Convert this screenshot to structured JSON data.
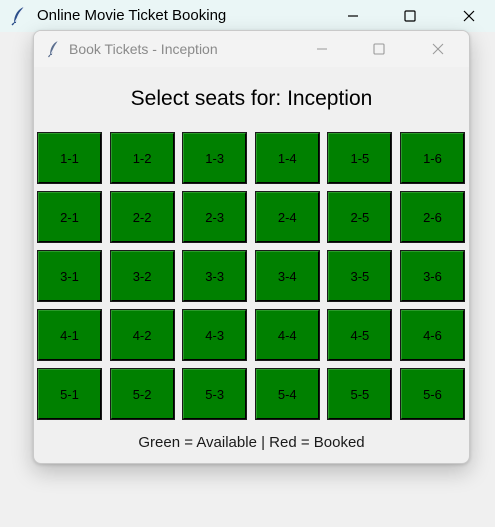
{
  "main_window": {
    "title": "Online Movie Ticket Booking"
  },
  "dialog": {
    "title": "Book Tickets - Inception",
    "heading": "Select seats for: Inception",
    "legend": "Green = Available | Red = Booked",
    "seats": [
      "1-1",
      "1-2",
      "1-3",
      "1-4",
      "1-5",
      "1-6",
      "2-1",
      "2-2",
      "2-3",
      "2-4",
      "2-5",
      "2-6",
      "3-1",
      "3-2",
      "3-3",
      "3-4",
      "3-5",
      "3-6",
      "4-1",
      "4-2",
      "4-3",
      "4-4",
      "4-5",
      "4-6",
      "5-1",
      "5-2",
      "5-3",
      "5-4",
      "5-5",
      "5-6"
    ],
    "seat_status": "available"
  },
  "colors": {
    "available": "#008000",
    "booked": "#ff0000"
  },
  "icons": {
    "app": "feather-icon",
    "minimize": "minimize-icon",
    "maximize": "maximize-icon",
    "close": "close-icon"
  }
}
